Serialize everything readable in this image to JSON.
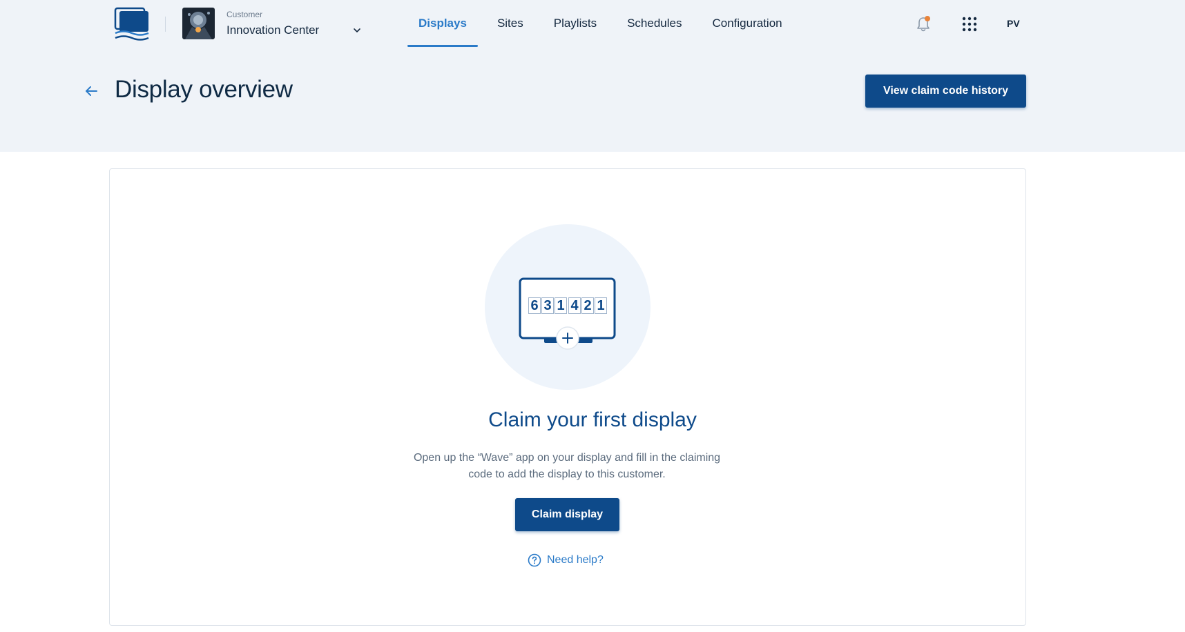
{
  "header": {
    "customer_caption": "Customer",
    "customer_name": "Innovation Center",
    "nav": [
      {
        "label": "Displays",
        "active": true
      },
      {
        "label": "Sites",
        "active": false
      },
      {
        "label": "Playlists",
        "active": false
      },
      {
        "label": "Schedules",
        "active": false
      },
      {
        "label": "Configuration",
        "active": false
      }
    ],
    "user_initials": "PV",
    "notification_dot_color": "#e8833a"
  },
  "page": {
    "title": "Display overview",
    "history_button": "View claim code history"
  },
  "empty_state": {
    "code_digits": [
      "6",
      "3",
      "1",
      "4",
      "2",
      "1"
    ],
    "title": "Claim your first display",
    "description": "Open up the “Wave” app on your display and fill in the claiming code to add the display to this customer.",
    "claim_button": "Claim display",
    "help_link": "Need help?"
  },
  "colors": {
    "brand": "#0e4a8a",
    "accent": "#2a7ac8",
    "band": "#eff3f8"
  }
}
